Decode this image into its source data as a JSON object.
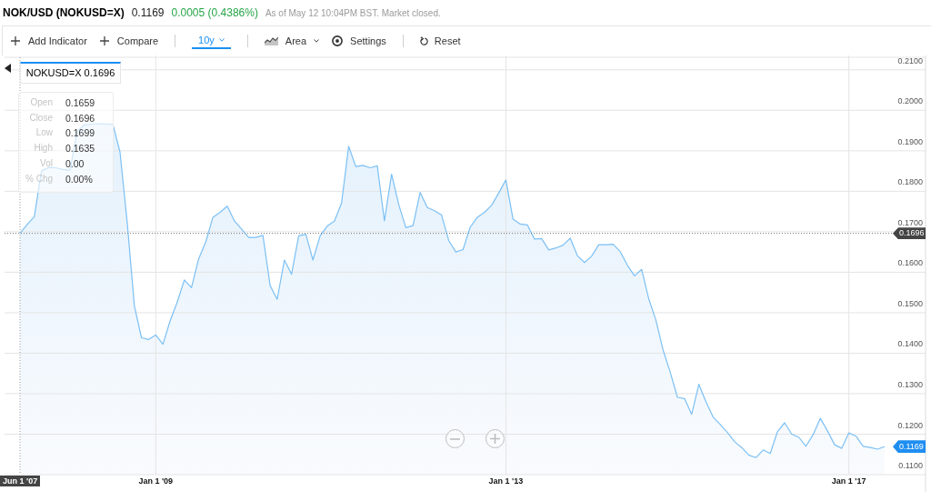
{
  "header": {
    "symbol": "NOK/USD (NOKUSD=X)",
    "price": "0.1169",
    "change": "0.0005 (0.4386%)",
    "change_positive": true,
    "status": "As of May 12 10:04PM BST. Market closed."
  },
  "toolbar": {
    "groups": [
      [
        {
          "kind": "add",
          "label": "Add Indicator"
        },
        {
          "kind": "add",
          "label": "Compare"
        }
      ],
      [
        {
          "kind": "range",
          "label": "10y"
        }
      ],
      [
        {
          "kind": "chart_type",
          "label": "Area"
        },
        {
          "kind": "settings",
          "label": "Settings"
        }
      ],
      [
        {
          "kind": "reset",
          "label": "Reset"
        }
      ]
    ]
  },
  "chart": {
    "tooltip": {
      "title": "NOKUSD=X 0.1696",
      "rows": [
        {
          "label": "Open",
          "value": "0.1659"
        },
        {
          "label": "Close",
          "value": "0.1696"
        },
        {
          "label": "Low",
          "value": "0.1699"
        },
        {
          "label": "High",
          "value": "0.1635"
        },
        {
          "label": "Vol",
          "value": "0.00"
        },
        {
          "label": "% Chg",
          "value": "0.00%"
        }
      ]
    },
    "chart_data": {
      "type": "area",
      "grid": true,
      "categories": [
        "Jun 1 '07",
        null,
        null,
        null,
        null,
        null,
        null,
        null,
        null,
        null,
        null,
        null,
        null,
        null,
        null,
        null,
        null,
        null,
        null,
        "Jan 1 '09",
        null,
        null,
        null,
        null,
        null,
        null,
        null,
        null,
        null,
        null,
        null,
        null,
        null,
        null,
        null,
        null,
        null,
        null,
        null,
        null,
        null,
        null,
        null,
        null,
        null,
        null,
        null,
        null,
        null,
        null,
        null,
        null,
        null,
        null,
        null,
        null,
        null,
        null,
        null,
        null,
        null,
        null,
        null,
        null,
        null,
        null,
        null,
        null,
        "Jan 1 '13",
        null,
        null,
        null,
        null,
        null,
        null,
        null,
        null,
        null,
        null,
        null,
        null,
        null,
        null,
        null,
        null,
        null,
        null,
        null,
        null,
        null,
        null,
        null,
        null,
        null,
        null,
        null,
        null,
        null,
        null,
        null,
        null,
        null,
        null,
        null,
        null,
        null,
        null,
        null,
        null,
        null,
        null,
        null,
        null,
        null,
        null,
        null,
        "Jan 1 '17",
        null,
        null,
        null,
        null,
        null
      ],
      "series": [
        {
          "color": "#7cc0f4",
          "values": [
            0.1696,
            0.1718,
            0.1737,
            0.185,
            0.1859,
            0.1858,
            0.1854,
            0.1852,
            0.1947,
            0.1964,
            0.1966,
            0.1967,
            0.1966,
            0.1965,
            0.1897,
            0.1723,
            0.1517,
            0.1438,
            0.1434,
            0.1445,
            0.1422,
            0.1479,
            0.1526,
            0.1581,
            0.1562,
            0.1633,
            0.1675,
            0.1736,
            0.1748,
            0.1763,
            0.1727,
            0.1707,
            0.1686,
            0.1686,
            0.1691,
            0.1567,
            0.1533,
            0.163,
            0.1595,
            0.169,
            0.1694,
            0.163,
            0.169,
            0.1714,
            0.1726,
            0.1771,
            0.1911,
            0.1861,
            0.1864,
            0.1858,
            0.1863,
            0.1727,
            0.1842,
            0.1767,
            0.171,
            0.1715,
            0.1797,
            0.176,
            0.1752,
            0.1741,
            0.1678,
            0.165,
            0.1656,
            0.1711,
            0.1736,
            0.1748,
            0.1765,
            0.1796,
            0.1828,
            0.1731,
            0.1719,
            0.1717,
            0.1682,
            0.1683,
            0.1655,
            0.166,
            0.1667,
            0.1684,
            0.1641,
            0.1624,
            0.164,
            0.1668,
            0.1668,
            0.1669,
            0.1651,
            0.1617,
            0.1591,
            0.1607,
            0.1534,
            0.1481,
            0.1407,
            0.1353,
            0.1291,
            0.1288,
            0.1249,
            0.1323,
            0.128,
            0.1242,
            0.1224,
            0.1204,
            0.1181,
            0.1167,
            0.1148,
            0.1142,
            0.1161,
            0.1152,
            0.1206,
            0.1228,
            0.12,
            0.1192,
            0.117,
            0.1199,
            0.1239,
            0.1208,
            0.1174,
            0.1165,
            0.1203,
            0.1195,
            0.117,
            0.1167,
            0.1163,
            0.1169
          ]
        }
      ],
      "ylim": [
        0.11,
        0.2131
      ],
      "yticks": [
        {
          "value": 0.11,
          "label": "0.1100"
        },
        {
          "value": 0.12,
          "label": "0.1200"
        },
        {
          "value": 0.13,
          "label": "0.1300"
        },
        {
          "value": 0.14,
          "label": "0.1400"
        },
        {
          "value": 0.15,
          "label": "0.1500"
        },
        {
          "value": 0.16,
          "label": "0.1600"
        },
        {
          "value": 0.17,
          "label": "0.1700"
        },
        {
          "value": 0.18,
          "label": "0.1800"
        },
        {
          "value": 0.19,
          "label": "0.1900"
        },
        {
          "value": 0.2,
          "label": "0.2000"
        },
        {
          "value": 0.21,
          "label": "0.2100"
        }
      ],
      "ref_lines": [
        {
          "axis": "y",
          "value": 0.1696,
          "label": "0.1696"
        },
        {
          "axis": "x",
          "value": "Jun 1 '07"
        }
      ],
      "annotations": [
        "0.1169"
      ]
    }
  }
}
